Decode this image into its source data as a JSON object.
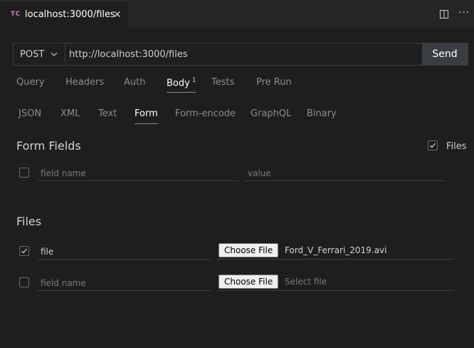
{
  "tab": {
    "logo": "TC",
    "title": "localhost:3000/files",
    "close": "✕",
    "more": "···"
  },
  "request": {
    "method": "POST",
    "url": "http://localhost:3000/files",
    "send_label": "Send"
  },
  "request_tabs": [
    {
      "label": "Query"
    },
    {
      "label": "Headers"
    },
    {
      "label": "Auth"
    },
    {
      "label": "Body",
      "badge": "1"
    },
    {
      "label": "Tests"
    },
    {
      "label": "Pre Run"
    }
  ],
  "body_tabs": [
    {
      "label": "JSON"
    },
    {
      "label": "XML"
    },
    {
      "label": "Text"
    },
    {
      "label": "Form"
    },
    {
      "label": "Form-encode"
    },
    {
      "label": "GraphQL"
    },
    {
      "label": "Binary"
    }
  ],
  "form_fields": {
    "title": "Form Fields",
    "files_toggle_label": "Files",
    "files_toggle_checked": true,
    "rows": [
      {
        "checked": false,
        "name_value": "",
        "name_placeholder": "field name",
        "value_value": "",
        "value_placeholder": "value"
      }
    ]
  },
  "files": {
    "title": "Files",
    "rows": [
      {
        "checked": true,
        "name_value": "file",
        "name_placeholder": "field name",
        "button_label": "Choose File",
        "file_label": "Ford_V_Ferrari_2019.avi"
      },
      {
        "checked": false,
        "name_value": "",
        "name_placeholder": "field name",
        "button_label": "Choose File",
        "file_label": "Select file"
      }
    ]
  },
  "colors": {
    "background": "#1e1e1e",
    "active_text": "#ffffff",
    "inactive_text": "#8c8c8c",
    "logo": "#c586c0"
  }
}
